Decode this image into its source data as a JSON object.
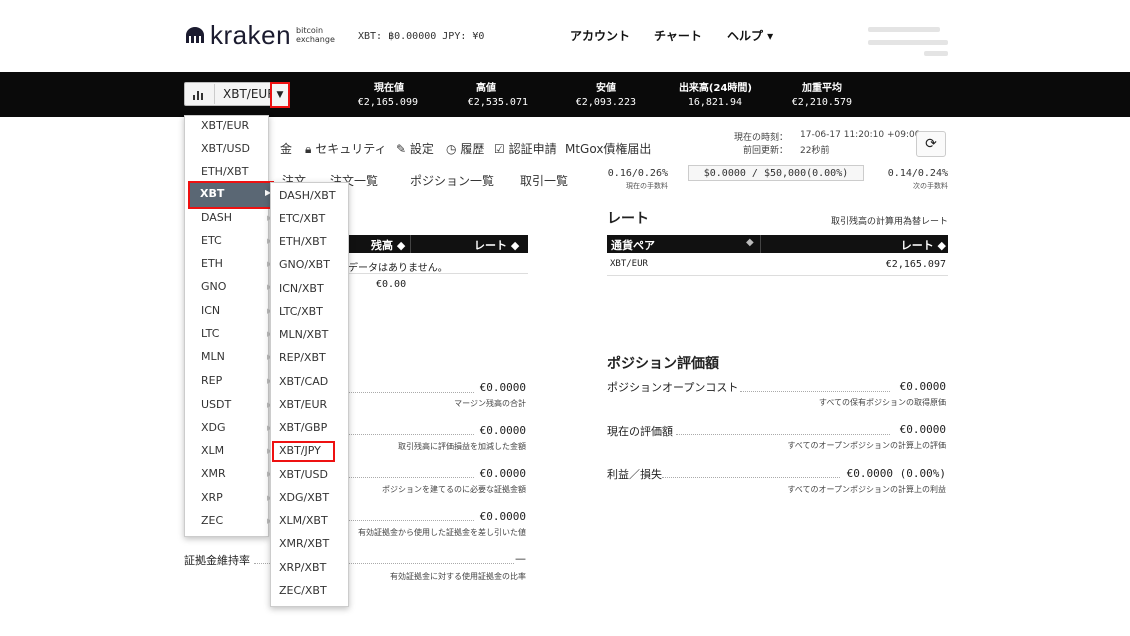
{
  "header": {
    "logo": {
      "name": "kraken",
      "tagline_1": "bitcoin",
      "tagline_2": "exchange"
    },
    "balance": "XBT: ฿0.00000  JPY: ¥0",
    "nav": [
      "アカウント",
      "チャート",
      "ヘルプ ▾"
    ]
  },
  "ticker": {
    "pair": "XBT/EUR",
    "stats": [
      {
        "label": "現在値",
        "value": "€2,165.099"
      },
      {
        "label": "高値",
        "value": "€2,535.071"
      },
      {
        "label": "安値",
        "value": "€2,093.223"
      },
      {
        "label": "出来高(24時間)",
        "value": "16,821.94"
      },
      {
        "label": "加重平均",
        "value": "€2,210.579"
      }
    ]
  },
  "pair_menu": {
    "items": [
      "XBT/EUR",
      "XBT/USD",
      "ETH/XBT",
      "XBT",
      "DASH",
      "ETC",
      "ETH",
      "GNO",
      "ICN",
      "LTC",
      "MLN",
      "REP",
      "USDT",
      "XDG",
      "XLM",
      "XMR",
      "XRP",
      "ZEC"
    ],
    "highlighted": "XBT"
  },
  "xbt_submenu": {
    "items": [
      "DASH/XBT",
      "ETC/XBT",
      "ETH/XBT",
      "GNO/XBT",
      "ICN/XBT",
      "LTC/XBT",
      "MLN/XBT",
      "REP/XBT",
      "XBT/CAD",
      "XBT/EUR",
      "XBT/GBP",
      "XBT/JPY",
      "XBT/USD",
      "XDG/XBT",
      "XLM/XBT",
      "XMR/XBT",
      "XRP/XBT",
      "ZEC/XBT"
    ],
    "highlighted": "XBT/JPY"
  },
  "subnav": {
    "items": [
      "金",
      "セキュリティ",
      "設定",
      "履歴",
      "認証申請",
      "MtGox債権届出"
    ],
    "time_label": "現在の時刻：",
    "time_value": "17-06-17 11:20:10 +09:00",
    "updated_label": "前回更新：",
    "updated_value": "22秒前"
  },
  "tabs": [
    "注文",
    "注文一覧",
    "ポジション一覧",
    "取引一覧"
  ],
  "fees": {
    "current": "0.16/0.26%",
    "current_label": "現在の手数料",
    "volume": "$0.0000 / $50,000(0.00%)",
    "next": "0.14/0.24%",
    "next_label": "次の手数料"
  },
  "balances": {
    "col_balance": "残高 ◆",
    "col_rate": "レート ◆",
    "empty": "データはありません。",
    "total": "€0.00"
  },
  "margin_rows": [
    {
      "value": "€0.0000",
      "note": "マージン残高の合計"
    },
    {
      "value": "€0.0000",
      "note": "取引残高に評価損益を加減した金額"
    },
    {
      "value": "€0.0000",
      "note": "ポジションを建てるのに必要な証拠金額"
    },
    {
      "value": "€0.0000",
      "note": "有効証拠金から使用した証拠金を差し引いた値"
    }
  ],
  "margin_level": {
    "label": "証拠金維持率",
    "value": "—",
    "note": "有効証拠金に対する使用証拠金の比率"
  },
  "rates": {
    "title": "レート",
    "link": "取引残高の計算用為替レート",
    "col_pair": "通貨ペア",
    "col_rate": "レート ◆",
    "row_pair": "XBT/EUR",
    "row_rate": "€2,165.097"
  },
  "position": {
    "title": "ポジション評価額",
    "rows": [
      {
        "label": "ポジションオープンコスト",
        "value": "€0.0000",
        "note": "すべての保有ポジションの取得原価"
      },
      {
        "label": "現在の評価額",
        "value": "€0.0000",
        "note": "すべてのオープンポジションの計算上の評価"
      },
      {
        "label": "利益／損失",
        "value": "€0.0000 (0.00%)",
        "note": "すべてのオープンポジションの計算上の利益"
      }
    ]
  }
}
